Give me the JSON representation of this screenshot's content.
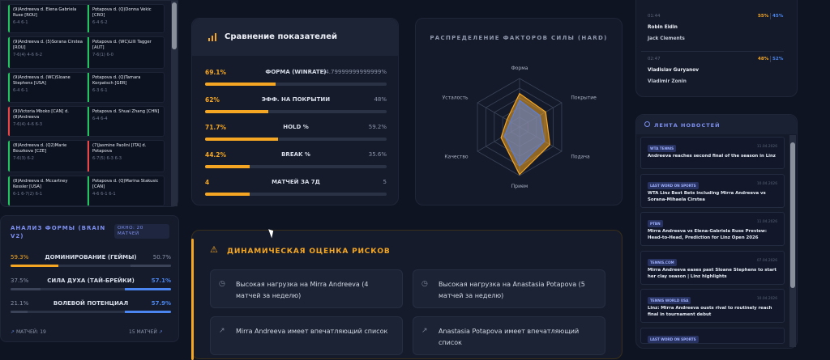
{
  "matches": [
    {
      "p1": "(9)Andreeva d. Elena Gabriela Ruse [ROU]",
      "s1": "6-4 6-1",
      "p2": "Potapova d. (Q)Donna Vekic [CRO]",
      "s2": "6-4 6-2"
    },
    {
      "p1": "(9)Andreeva d. (5)Sorana Cirstea [ROU]",
      "s1": "7-6(4) 4-6 6-2",
      "p2": "Potapova d. (WC)Lilli Tagger [AUT]",
      "s2": "7-6(1) 6-0"
    },
    {
      "p1": "(9)Andreeva d. (WC)Sloane Stephens [USA]",
      "s1": "6-4 6-1",
      "p2": "Potapova d. (Q)Tamara Korpatsch [GER]",
      "s2": "6-3 6-1"
    },
    {
      "p1": "(9)Victoria Mboko [CAN] d. (8)Andreeva",
      "s1": "7-6(4) 4-6 6-3",
      "p2": "Potapova d. Shuai Zhang [CHN]",
      "s2": "6-4 6-4"
    },
    {
      "p1": "(8)Andreeva d. (Q2)Marie Bouzkova [CZE]",
      "s1": "7-6(3) 6-2",
      "p2": "(7)Jasmine Paolini [ITA] d. Potapova",
      "s2": "6-7(5) 6-3 6-3"
    },
    {
      "p1": "(8)Andreeva d. Mccartney Kessler [USA]",
      "s1": "6-1 6-7(2) 6-1",
      "p2": "Potapova d. (Q)Marina Stakusic [CAN]",
      "s2": "4-6 6-1 6-1"
    }
  ],
  "form": {
    "title": "АНАЛИЗ ФОРМЫ (BRAIN V2)",
    "badge": "ОКНО: 20 МАТЧЕЙ",
    "rows": [
      {
        "left": "59.3%",
        "label": "ДОМИНИРОВАНИЕ (ГЕЙМЫ)",
        "right": "50.7%",
        "left_fill": 0.593,
        "right_fill": 0.507
      },
      {
        "left": "37.5%",
        "label": "СИЛА ДУХА (ТАЙ-БРЕЙКИ)",
        "right": "57.1%",
        "left_fill": 0.375,
        "right_fill": 0.571
      },
      {
        "left": "21.1%",
        "label": "ВОЛЕВОЙ ПОТЕНЦИАЛ",
        "right": "57.9%",
        "left_fill": 0.211,
        "right_fill": 0.579
      }
    ],
    "footer_left": "МАТЧЕЙ: 19",
    "footer_right": "15 МАТЧЕЙ"
  },
  "compare": {
    "title": "Сравнение показателей",
    "rows": [
      {
        "left": "69.1%",
        "label": "ФОРМА (WINRATE)",
        "right": "54.79999999999999%",
        "fill": 0.691
      },
      {
        "left": "62%",
        "label": "ЭФФ. НА ПОКРЫТИИ",
        "right": "48%",
        "fill": 0.62
      },
      {
        "left": "71.7%",
        "label": "HOLD %",
        "right": "59.2%",
        "fill": 0.717
      },
      {
        "left": "44.2%",
        "label": "BREAK %",
        "right": "35.6%",
        "fill": 0.442
      },
      {
        "left": "4",
        "label": "МАТЧЕЙ ЗА 7Д",
        "right": "5",
        "fill": 0.44
      }
    ]
  },
  "radar": {
    "title": "РАСПРЕДЕЛЕНИЕ ФАКТОРОВ СИЛЫ (HARD)",
    "axes": [
      "Форма",
      "Покрытие",
      "Подача",
      "Прием",
      "Качество",
      "Усталость"
    ],
    "series": [
      {
        "color": "#f5a623",
        "values": [
          0.69,
          0.62,
          0.72,
          0.98,
          0.44,
          0.3
        ]
      },
      {
        "color": "#5b7fd6",
        "values": [
          0.55,
          0.48,
          0.59,
          0.8,
          0.36,
          0.22
        ]
      }
    ]
  },
  "risk": {
    "title": "ДИНАМИЧЕСКАЯ ОЦЕНКА РИСКОВ",
    "items": [
      {
        "text": "Высокая нагрузка на Mirra Andreeva (4 матчей за неделю)"
      },
      {
        "text": "Высокая нагрузка на Anastasia Potapova (5 матчей за неделю)"
      },
      {
        "text": "Mirra Andreeva имеет впечатляющий список"
      },
      {
        "text": "Anastasia Potapova имеет впечатляющий список"
      }
    ]
  },
  "live": [
    {
      "time": "01:44",
      "p1": "Robin Eidin",
      "p2": "Jack Clements",
      "o1": "55%",
      "o2": "45%"
    },
    {
      "time": "02:47",
      "p1": "Vladislav Guryanov",
      "p2": "Vladimir Zonin",
      "o1": "48%",
      "o2": "52%"
    }
  ],
  "news": {
    "title": "ЛЕНТА НОВОСТЕЙ",
    "items": [
      {
        "tag": "WTA TENNIS",
        "date": "11.04.2026",
        "title": "Andreeva reaches second final of the season in Linz"
      },
      {
        "tag": "LAST WORD ON SPORTS",
        "date": "10.04.2026",
        "title": "WTA Linz Best Bets including Mirra Andreeva vs Sorana-Mihaela Cirstea"
      },
      {
        "tag": "PTBN",
        "date": "11.04.2026",
        "title": "Mirra Andreeva vs Elena-Gabriela Ruse Preview: Head-to-Head, Prediction for Linz Open 2026"
      },
      {
        "tag": "TENNIS.COM",
        "date": "07.04.2026",
        "title": "Mirra Andreeva eases past Sloane Stephens to start her clay season | Linz highlights"
      },
      {
        "tag": "TENNIS WORLD USA",
        "date": "10.04.2026",
        "title": "Linz: Mirra Andreeva ousts rival to routinely reach final in tournament debut"
      },
      {
        "tag": "LAST WORD ON SPORTS",
        "date": "",
        "title": ""
      }
    ]
  },
  "colors": {
    "accent": "#f5a623",
    "blue": "#4b86f0",
    "win": "#22c55e",
    "loss": "#ef4444"
  }
}
